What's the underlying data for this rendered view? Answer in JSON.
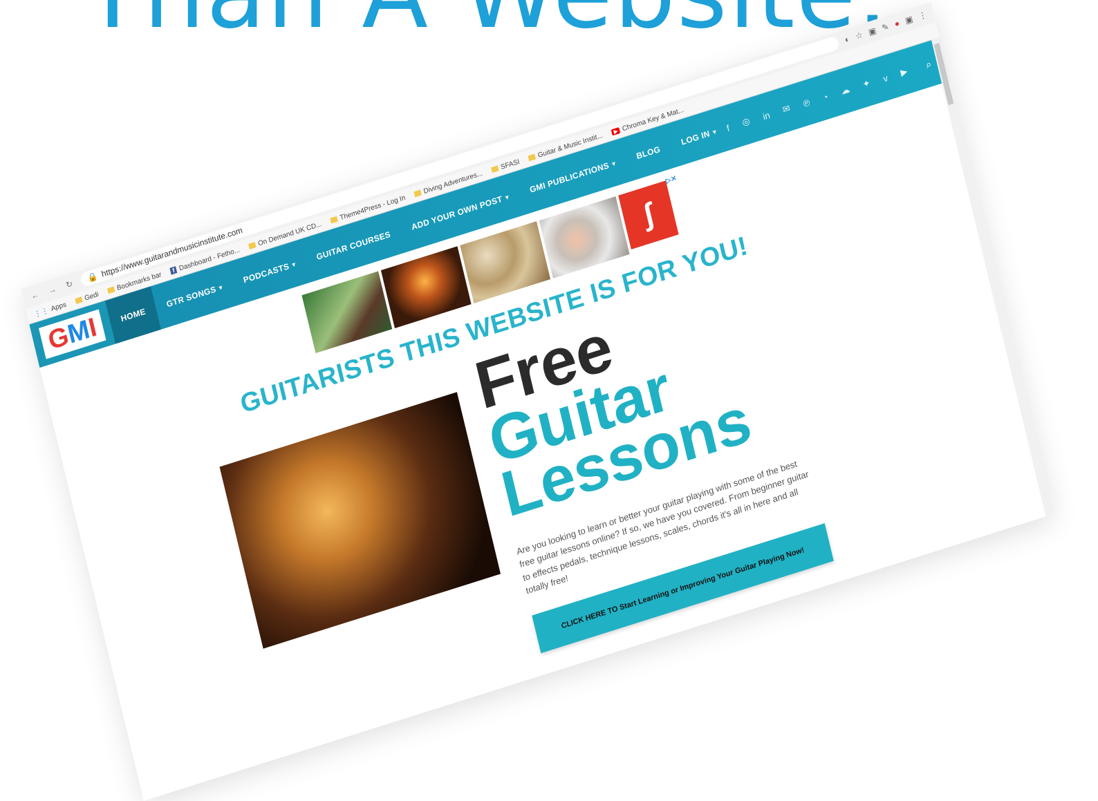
{
  "headline": "Than A Website.",
  "browser": {
    "url": "https://www.guitarandmusicinstitute.com",
    "bookmarks": [
      {
        "label": "Apps",
        "kind": "apps"
      },
      {
        "label": "Gedi",
        "kind": "folder"
      },
      {
        "label": "Bookmarks bar",
        "kind": "folder"
      },
      {
        "label": "Dashboard - Fetho...",
        "kind": "fb"
      },
      {
        "label": "On Demand UK CD...",
        "kind": "folder"
      },
      {
        "label": "Theme4Press - Log In",
        "kind": "folder"
      },
      {
        "label": "Diving Adventures...",
        "kind": "folder"
      },
      {
        "label": "SFASI",
        "kind": "folder"
      },
      {
        "label": "Guitar & Music Instit...",
        "kind": "folder"
      },
      {
        "label": "Chroma Key & Mat...",
        "kind": "yt"
      }
    ]
  },
  "site": {
    "logo": {
      "g": "G",
      "m": "M",
      "i": "I"
    },
    "nav": [
      {
        "label": "HOME",
        "active": true,
        "caret": false
      },
      {
        "label": "GTR SONGS",
        "active": false,
        "caret": true
      },
      {
        "label": "PODCASTS",
        "active": false,
        "caret": true
      },
      {
        "label": "GUITAR COURSES",
        "active": false,
        "caret": false
      },
      {
        "label": "ADD YOUR OWN POST",
        "active": false,
        "caret": true
      },
      {
        "label": "GMI PUBLICATIONS",
        "active": false,
        "caret": true
      },
      {
        "label": "BLOG",
        "active": false,
        "caret": false
      },
      {
        "label": "LOG IN",
        "active": false,
        "caret": true
      }
    ],
    "social": [
      {
        "name": "facebook-icon",
        "glyph": "f"
      },
      {
        "name": "instagram-icon",
        "glyph": "◎"
      },
      {
        "name": "linkedin-icon",
        "glyph": "in"
      },
      {
        "name": "email-icon",
        "glyph": "✉"
      },
      {
        "name": "pinterest-icon",
        "glyph": "℗"
      },
      {
        "name": "rss-icon",
        "glyph": "◔"
      },
      {
        "name": "soundcloud-icon",
        "glyph": "☁"
      },
      {
        "name": "twitter-icon",
        "glyph": "✦"
      },
      {
        "name": "vimeo-icon",
        "glyph": "v"
      },
      {
        "name": "youtube-icon",
        "glyph": "▶"
      }
    ]
  },
  "content": {
    "tagline": "GUITARISTS THIS WEBSITE IS FOR YOU!",
    "hero": {
      "free": "Free",
      "guitar": "Guitar",
      "lessons": "Lessons",
      "description": "Are you looking to learn or better your guitar playing with some of the best free guitar lessons online? If so, we have you covered. From beginner guitar to effects pedals, technique lessons, scales, chords it's all in here and all totally free!",
      "cta": "CLICK HERE TO Start Learning or Improving Your Guitar Playing Now!"
    }
  },
  "colors": {
    "accent": "#21b1c4",
    "headline": "#1ea0d8",
    "nav_bg": "#168db0"
  }
}
